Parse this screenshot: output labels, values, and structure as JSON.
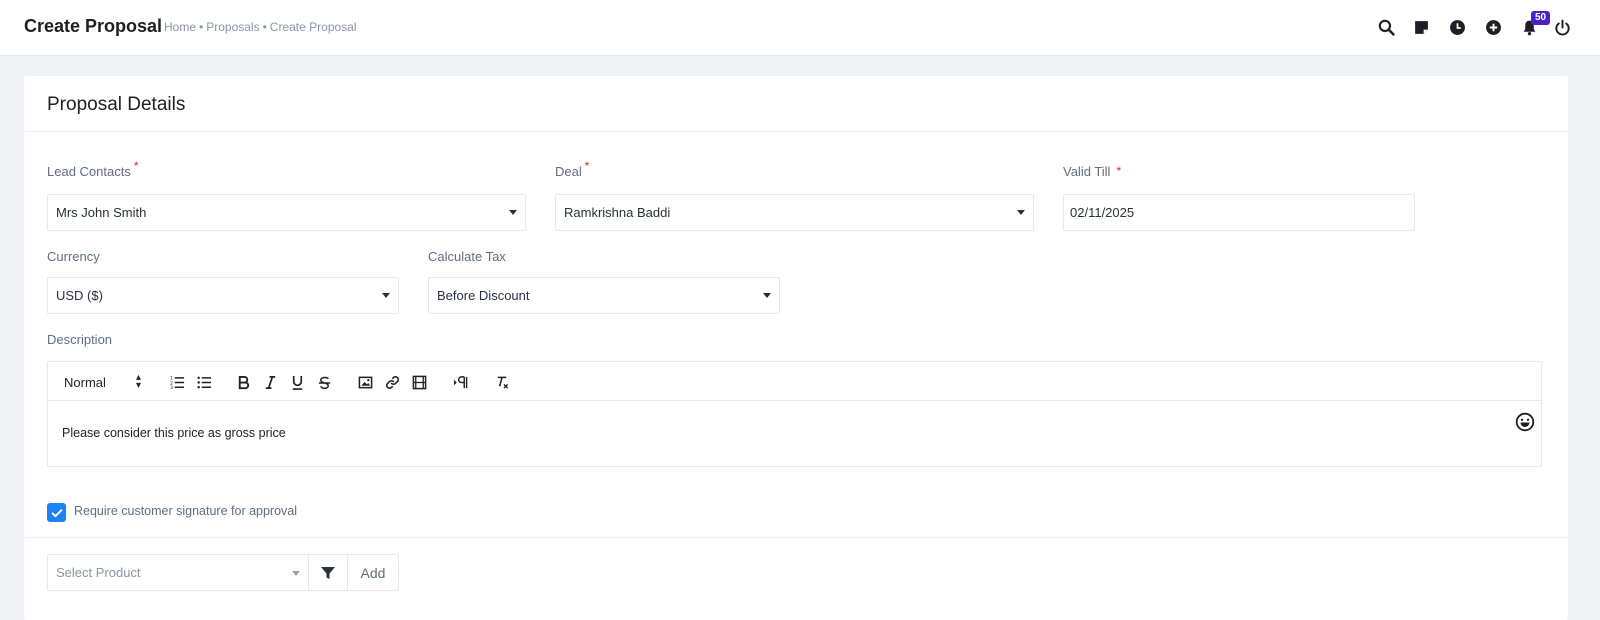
{
  "header": {
    "title": "Create Proposal",
    "breadcrumb": [
      "Home",
      "Proposals",
      "Create Proposal"
    ],
    "breadcrumb_separator": "•",
    "icons": [
      "search-icon",
      "sticky-note-icon",
      "clock-icon",
      "plus-circle-icon",
      "bell-icon",
      "power-icon"
    ],
    "notification_count": "50"
  },
  "card": {
    "title": "Proposal Details"
  },
  "form": {
    "lead_contacts": {
      "label": "Lead Contacts",
      "required": "*",
      "value": "Mrs John Smith"
    },
    "deal": {
      "label": "Deal",
      "required": "*",
      "value": "Ramkrishna Baddi"
    },
    "valid_till": {
      "label": "Valid Till",
      "required": "*",
      "value": "02/11/2025"
    },
    "currency": {
      "label": "Currency",
      "value": "USD ($)"
    },
    "calculate_tax": {
      "label": "Calculate Tax",
      "value": "Before Discount"
    },
    "description": {
      "label": "Description",
      "format_value": "Normal",
      "toolbar_icons": [
        "ordered-list-icon",
        "bullet-list-icon",
        "bold-icon",
        "italic-icon",
        "underline-icon",
        "strikethrough-icon",
        "image-icon",
        "link-icon",
        "video-icon",
        "rtl-direction-icon",
        "clear-format-icon"
      ],
      "content": "Please consider this price as gross price"
    },
    "signature": {
      "label": "Require customer signature for approval",
      "checked": true
    }
  },
  "product": {
    "placeholder": "Select Product",
    "add_label": "Add"
  },
  "colors": {
    "accent": "#1d82f5",
    "badge": "#4b20c8",
    "required": "#e52424"
  }
}
